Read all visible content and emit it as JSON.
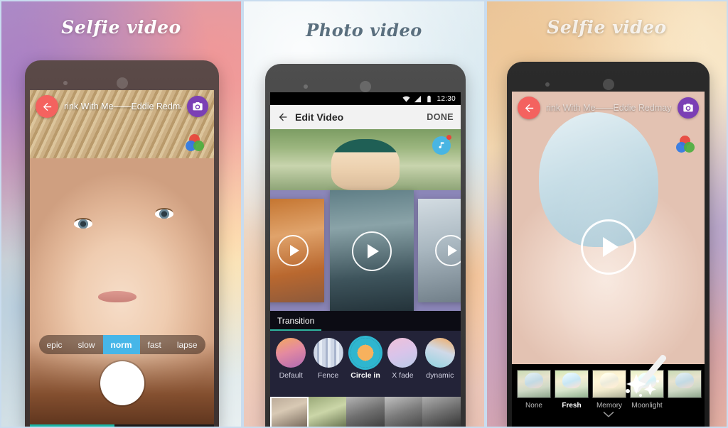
{
  "panels": [
    {
      "title": "Selfie video",
      "topbar": {
        "song": "rink With Me——Eddie Redmay",
        "back_icon": "arrow-left-icon",
        "camera_icon": "camera-switch-icon"
      },
      "filter_icon": "color-filter-icon",
      "speed_options": [
        "epic",
        "slow",
        "norm",
        "fast",
        "lapse"
      ],
      "speed_selected": "norm",
      "shutter": "record-shutter-button",
      "progress_percent": 46,
      "accent_back": "#f4625f",
      "accent_camera": "#7b3fb5",
      "accent_speed": "#46b6e8",
      "accent_progress": "#19b5a5"
    },
    {
      "title": "Photo video",
      "status": {
        "time": "12:30",
        "wifi_icon": "wifi-icon",
        "signal_icon": "signal-icon",
        "battery_icon": "battery-icon"
      },
      "appbar": {
        "back_icon": "arrow-left-icon",
        "title": "Edit Video",
        "done_label": "DONE"
      },
      "music_icon": "music-note-icon",
      "play_icon": "play-icon",
      "transition": {
        "section_label": "Transition",
        "items": [
          "Default",
          "Fence",
          "Circle in",
          "X fade",
          "dynamic"
        ],
        "selected": "Circle in"
      },
      "accent_tab": "#2fb6a0",
      "accent_music": "#49b5e3"
    },
    {
      "title": "Selfie video",
      "topbar": {
        "song": "rink With Me——Eddie Redmay",
        "back_icon": "arrow-left-icon",
        "camera_icon": "camera-switch-icon"
      },
      "filter_icon": "color-filter-icon",
      "play_icon": "play-icon",
      "filters": {
        "items": [
          "None",
          "Fresh",
          "Memory",
          "Moonlight"
        ],
        "selected": "Fresh"
      },
      "collapse_icon": "chevron-down-icon",
      "wand_icon": "magic-wand-icon",
      "accent_back": "#f4625f",
      "accent_camera": "#7b3fb5"
    }
  ]
}
